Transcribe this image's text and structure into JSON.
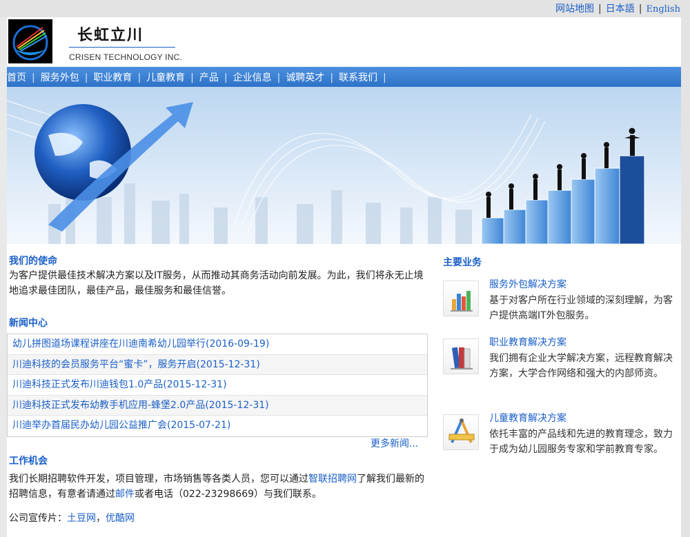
{
  "toplinks": {
    "sitemap": "网站地图",
    "japanese": "日本語",
    "english": "English"
  },
  "brand": {
    "name_cn": "长虹立川",
    "name_en": "CRISEN TECHNOLOGY INC."
  },
  "nav": [
    "首页",
    "服务外包",
    "职业教育",
    "儿童教育",
    "产品",
    "企业信息",
    "诚聘英才",
    "联系我们"
  ],
  "mission": {
    "title": "我们的使命",
    "text": "为客户提供最佳技术解决方案以及IT服务，从而推动其商务活动向前发展。为此，我们将永无止境地追求最佳团队，最佳产品，最佳服务和最佳信誉。"
  },
  "news": {
    "title": "新闻中心",
    "items": [
      "幼儿拼图道场课程讲座在川迪南希幼儿园举行(2016-09-19)",
      "川迪科技的会员服务平台“蜜卡”，服务开启(2015-12-31)",
      "川迪科技正式发布川迪钱包1.0产品(2015-12-31)",
      "川迪科技正式发布幼教手机应用-蜂堡2.0产品(2015-12-31)",
      "川迪举办首届民办幼儿园公益推广会(2015-07-21)"
    ],
    "more": "更多新闻..."
  },
  "jobs": {
    "title": "工作机会",
    "text1": "我们长期招聘软件开发，项目管理，市场销售等各类人员，您可以通过",
    "link1": "智联招聘网",
    "text2": "了解我们最新的招聘信息，有意者请通过",
    "link2": "邮件",
    "text3": "或者电话（022-23298669）与我们联系。"
  },
  "promo": {
    "label": "公司宣传片：",
    "link1": "土豆网",
    "comma": "，",
    "link2": "优酷网"
  },
  "business": {
    "title": "主要业务",
    "items": [
      {
        "title": "服务外包解决方案",
        "desc": "基于对客户所在行业领域的深刻理解，为客户提供高端IT外包服务。",
        "icon": "bar-chart-icon"
      },
      {
        "title": "职业教育解决方案",
        "desc": "我们拥有企业大学解决方案，远程教育解决方案，大学合作网络和强大的内部师资。",
        "icon": "books-icon"
      },
      {
        "title": "儿童教育解决方案",
        "desc": "依托丰富的产品线和先进的教育理念，致力于成为幼儿园服务专家和学前教育专家。",
        "icon": "drafting-tools-icon"
      }
    ]
  },
  "colors": {
    "link": "#1a5fc8",
    "nav": "#3a7fd5"
  }
}
